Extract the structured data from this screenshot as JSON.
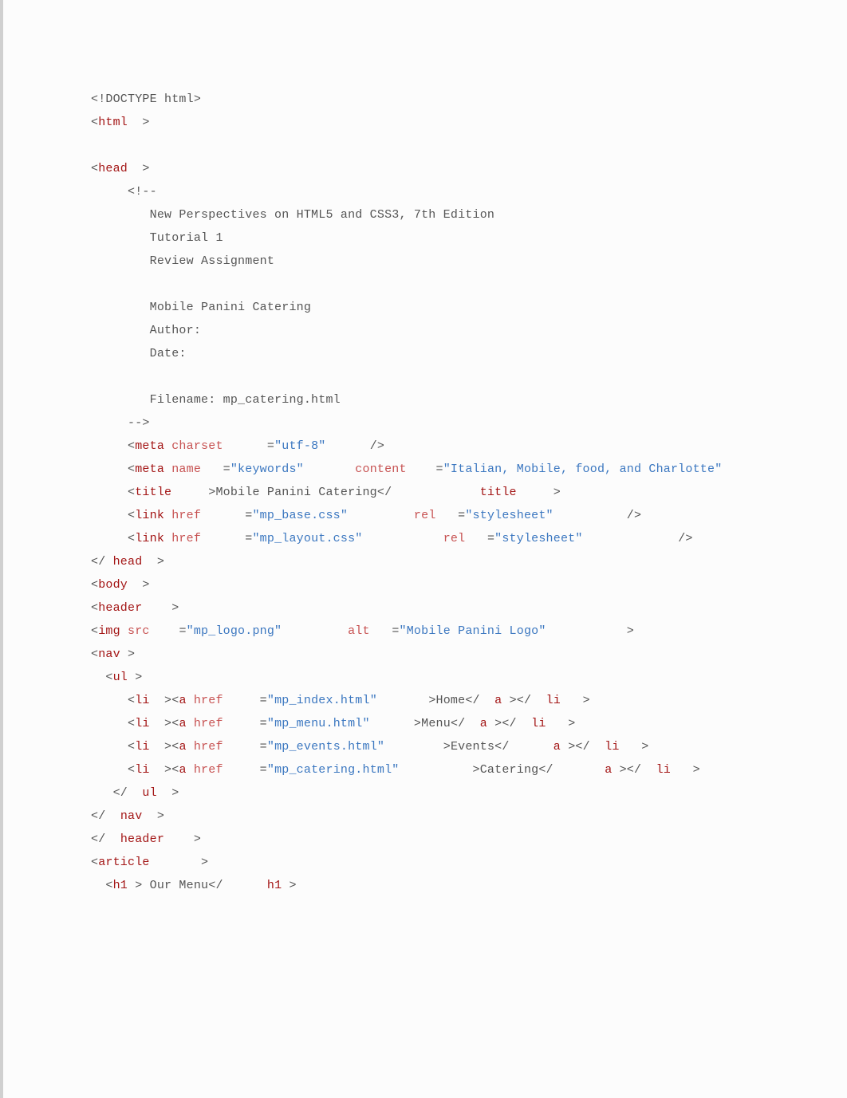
{
  "doctype": "<!DOCTYPE html>",
  "tags": {
    "html": "html",
    "head": "head",
    "meta": "meta",
    "title": "title",
    "link": "link",
    "body": "body",
    "header": "header",
    "img": "img",
    "nav": "nav",
    "ul": "ul",
    "li": "li",
    "a": "a",
    "article": "article",
    "h1": "h1"
  },
  "attrs": {
    "charset": "charset",
    "name": "name",
    "content": "content",
    "href": "href",
    "rel": "rel",
    "src": "src",
    "alt": "alt"
  },
  "comment": {
    "open": "<!--",
    "l1": "New Perspectives on HTML5 and CSS3, 7th Edition",
    "l2": "Tutorial 1",
    "l3": "Review Assignment",
    "l4": "Mobile Panini Catering",
    "l5": "Author:",
    "l6": "Date:",
    "l7": "Filename: mp_catering.html",
    "close": "-->"
  },
  "values": {
    "charset": "\"utf-8\"",
    "keywords_name": "\"keywords\"",
    "keywords_content": "\"Italian, Mobile, food, and Charlotte\"",
    "title_text": "Mobile Panini Catering",
    "css1": "\"mp_base.css\"",
    "css2": "\"mp_layout.css\"",
    "rel_stylesheet": "\"stylesheet\"",
    "logo_src": "\"mp_logo.png\"",
    "logo_alt": "\"Mobile Panini Logo\"",
    "href_index": "\"mp_index.html\"",
    "href_menu": "\"mp_menu.html\"",
    "href_events": "\"mp_events.html\"",
    "href_catering": "\"mp_catering.html\""
  },
  "text": {
    "home": "Home",
    "menu": "Menu",
    "events": "Events",
    "catering": "Catering",
    "our_menu": " Our Menu"
  },
  "sym": {
    "lt": "<",
    "gt": ">",
    "ltSlash": "</",
    "selfClose": "/>",
    "eq": "="
  }
}
